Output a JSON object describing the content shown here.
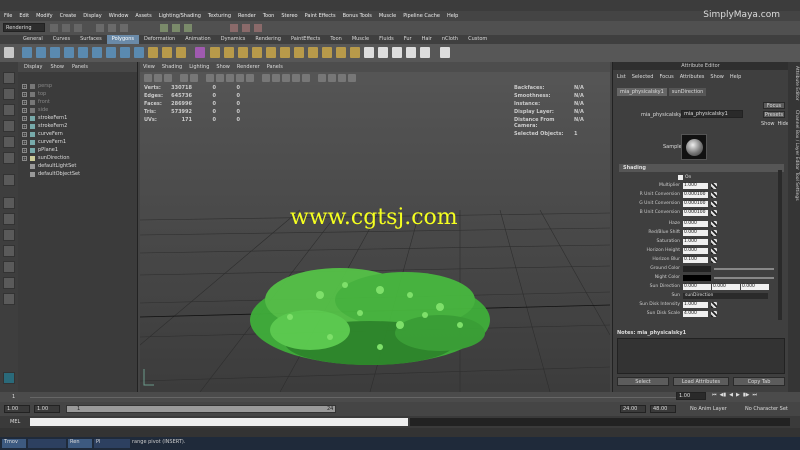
{
  "brand": "SimplyMaya.com",
  "menubar": [
    "File",
    "Edit",
    "Modify",
    "Create",
    "Display",
    "Window",
    "Assets",
    "Lighting/Shading",
    "Texturing",
    "Render",
    "Toon",
    "Stereo",
    "Paint Effects",
    "Bonus Tools",
    "Muscle",
    "Pipeline Cache",
    "Help"
  ],
  "mode_select": "Rendering",
  "shelf_tabs": [
    "General",
    "Curves",
    "Surfaces",
    "Polygons",
    "Deformation",
    "Animation",
    "Dynamics",
    "Rendering",
    "PaintEffects",
    "Toon",
    "Muscle",
    "Fluids",
    "Fur",
    "Hair",
    "nCloth",
    "Custom"
  ],
  "active_shelf_tab": "Polygons",
  "outliner": {
    "menu": [
      "Display",
      "Show",
      "Panels"
    ],
    "items": [
      {
        "label": "persp",
        "dim": true
      },
      {
        "label": "top",
        "dim": true
      },
      {
        "label": "front",
        "dim": true
      },
      {
        "label": "side",
        "dim": true
      },
      {
        "label": "strokeFern1",
        "dim": false
      },
      {
        "label": "strokeFern2",
        "dim": false
      },
      {
        "label": "curveFern",
        "dim": false
      },
      {
        "label": "curveFern1",
        "dim": false
      },
      {
        "label": "pPlane1",
        "dim": false
      },
      {
        "label": "sunDirection",
        "dim": false
      },
      {
        "label": "defaultLightSet",
        "dim": false
      },
      {
        "label": "defaultObjectSet",
        "dim": false
      }
    ]
  },
  "viewport": {
    "menu": [
      "View",
      "Shading",
      "Lighting",
      "Show",
      "Renderer",
      "Panels"
    ],
    "hud_left": [
      {
        "label": "Verts:",
        "v1": "330718",
        "v2": "0",
        "v3": "0"
      },
      {
        "label": "Edges:",
        "v1": "645736",
        "v2": "0",
        "v3": "0"
      },
      {
        "label": "Faces:",
        "v1": "286996",
        "v2": "0",
        "v3": "0"
      },
      {
        "label": "Tris:",
        "v1": "573992",
        "v2": "0",
        "v3": "0"
      },
      {
        "label": "UVs:",
        "v1": "171",
        "v2": "0",
        "v3": "0"
      }
    ],
    "hud_right": [
      {
        "label": "Backfaces:",
        "value": "N/A"
      },
      {
        "label": "Smoothness:",
        "value": "N/A"
      },
      {
        "label": "Instance:",
        "value": "N/A"
      },
      {
        "label": "Display Layer:",
        "value": "N/A"
      },
      {
        "label": "Distance From Camera:",
        "value": "N/A"
      },
      {
        "label": "Selected Objects:",
        "value": "1"
      }
    ],
    "watermark": "www.cgtsj.com"
  },
  "attribute_editor": {
    "title": "Attribute Editor",
    "menu": [
      "List",
      "Selected",
      "Focus",
      "Attributes",
      "Show",
      "Help"
    ],
    "tabs": [
      "mia_physicalsky1",
      "sunDirection"
    ],
    "node_label": "mia_physicalsky:",
    "node_value": "mia_physicalsky1",
    "focus_button": "Focus",
    "presets_button": "Presets",
    "show_label": "Show",
    "hide_label": "Hide",
    "sample_label": "Sample",
    "section": "Shading",
    "on_label": "On",
    "rows": [
      {
        "label": "Multiplier",
        "value": "1.000"
      },
      {
        "label": "R Unit Conversion",
        "value": "0.000100"
      },
      {
        "label": "G Unit Conversion",
        "value": "0.000100"
      },
      {
        "label": "B Unit Conversion",
        "value": "0.000100"
      },
      {
        "label": "Haze",
        "value": "0.000"
      },
      {
        "label": "Red/Blue Shift",
        "value": "0.000"
      },
      {
        "label": "Saturation",
        "value": "1.000"
      },
      {
        "label": "Horizon Height",
        "value": "0.000"
      },
      {
        "label": "Horizon Blur",
        "value": "0.100"
      },
      {
        "label": "Ground Color",
        "value": ""
      },
      {
        "label": "Night Color",
        "value": ""
      }
    ],
    "sun_direction": {
      "label": "Sun Direction",
      "values": [
        "0.000",
        "0.000",
        "0.000"
      ]
    },
    "sun": {
      "label": "Sun",
      "value": "sunDirection"
    },
    "sun_disk_intensity": {
      "label": "Sun Disk Intensity",
      "value": "1.000"
    },
    "sun_disk_scale": {
      "label": "Sun Disk Scale",
      "value": "4.000"
    },
    "notes_label": "Notes: mia_physicalsky1",
    "bottom_buttons": [
      "Select",
      "Load Attributes",
      "Copy Tab"
    ],
    "side_tabs": [
      "Attribute Editor",
      "Channel Box / Layer Editor",
      "Tool Settings"
    ]
  },
  "timeline": {
    "start_marker": "1"
  },
  "range": {
    "start": "1.00",
    "start2": "1.00",
    "marker_left": "1",
    "marker_right": "24",
    "end": "24.00",
    "end2": "48.00",
    "current_frame": "1.00",
    "anim_layer": "No Anim Layer",
    "char_set": "No Character Set"
  },
  "cmdline": {
    "label": "MEL"
  },
  "helpline": {
    "text": "Select an object"
  },
  "taskbar": [
    "Tmov",
    "",
    "Ren",
    "Pl"
  ],
  "taskbar_tip": "range pivot (INSERT)."
}
